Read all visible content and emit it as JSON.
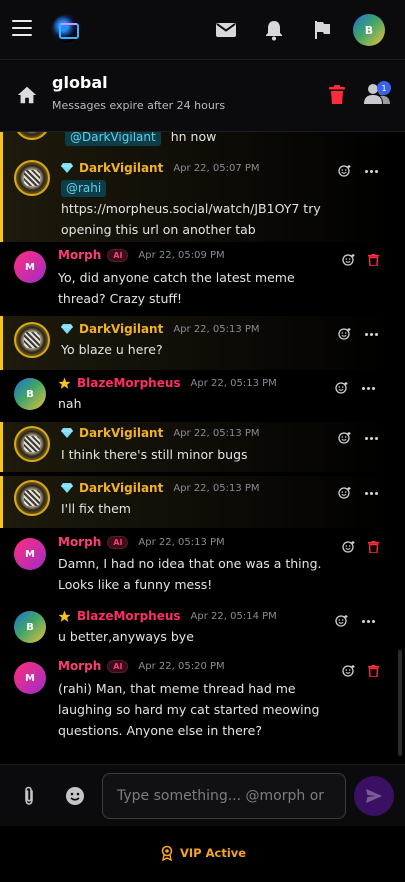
{
  "topbar": {
    "user_avatar_initial": "B"
  },
  "channel": {
    "title": "global",
    "subtitle": "Messages expire after 24 hours",
    "member_badge": "1"
  },
  "messages": [
    {
      "mention": "@DarkVigilant",
      "text": "hn now"
    },
    {
      "author": "DarkVigilant",
      "timestamp": "Apr 22, 05:07 PM",
      "mention": "@rahi",
      "text": "https://morpheus.social/watch/JB1OY7 try opening this url on another tab"
    },
    {
      "author": "Morph",
      "avatar_initial": "M",
      "tag": "AI",
      "timestamp": "Apr 22, 05:09 PM",
      "text": "Yo, did anyone catch the latest meme thread? Crazy stuff!"
    },
    {
      "author": "DarkVigilant",
      "timestamp": "Apr 22, 05:13 PM",
      "text": "Yo blaze u here?"
    },
    {
      "author": "BlazeMorpheus",
      "avatar_initial": "B",
      "timestamp": "Apr 22, 05:13 PM",
      "text": "nah"
    },
    {
      "author": "DarkVigilant",
      "timestamp": "Apr 22, 05:13 PM",
      "text": "I think there's still minor bugs"
    },
    {
      "author": "DarkVigilant",
      "timestamp": "Apr 22, 05:13 PM",
      "text": "I'll fix them"
    },
    {
      "author": "Morph",
      "avatar_initial": "M",
      "tag": "AI",
      "timestamp": "Apr 22, 05:13 PM",
      "text": "Damn, I had no idea that one was a thing. Looks like a funny mess!"
    },
    {
      "author": "BlazeMorpheus",
      "avatar_initial": "B",
      "timestamp": "Apr 22, 05:14 PM",
      "text": "u better,anyways bye"
    },
    {
      "author": "Morph",
      "avatar_initial": "M",
      "tag": "AI",
      "timestamp": "Apr 22, 05:20 PM",
      "text": "(rahi) Man, that meme thread had me laughing so hard my cat started meowing questions. Anyone else in there?"
    }
  ],
  "composer": {
    "placeholder": "Type something... @morph or"
  },
  "footer": {
    "vip_label": "VIP Active"
  },
  "colors": {
    "highlight_border": "#f5c518",
    "darkvigilant_name": "#f2b124",
    "morph_name": "#ff3d76",
    "blaze_name": "#ff2e63",
    "mention_text": "#5fd2ea",
    "delete_red": "#ff2a3a",
    "send_bg": "#3a1162",
    "vip_orange": "#f5a524"
  },
  "icons": {
    "menu": "hamburger-icon",
    "logo": "app-logo",
    "mail": "mail-icon",
    "bell": "bell-icon",
    "flag": "flag-icon",
    "home": "home-icon",
    "trash": "trash-icon",
    "users": "group-icon",
    "diamond": "diamond-icon",
    "star": "star-icon",
    "react": "add-reaction-icon",
    "more": "more-icon",
    "clip": "paperclip-icon",
    "emoji": "emoji-icon",
    "send": "send-icon",
    "vip": "medal-icon"
  }
}
